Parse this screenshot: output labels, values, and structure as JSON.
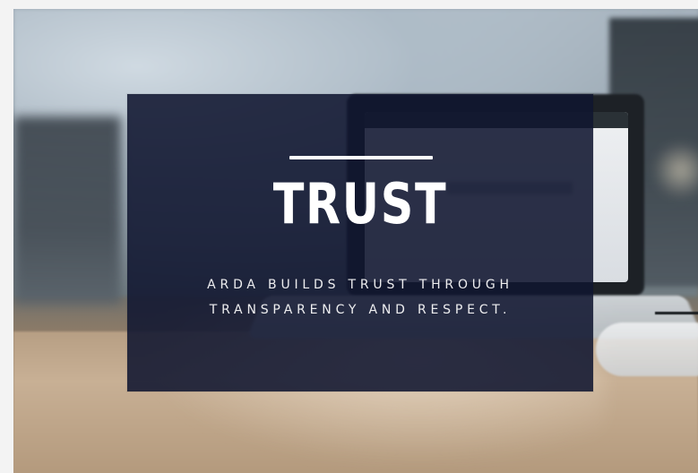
{
  "card": {
    "title": "TRUST",
    "lines": [
      "ARDA BUILDS TRUST THROUGH",
      "TRANSPARENCY AND RESPECT."
    ]
  },
  "colors": {
    "overlay": "#101630",
    "text": "#ffffff"
  }
}
